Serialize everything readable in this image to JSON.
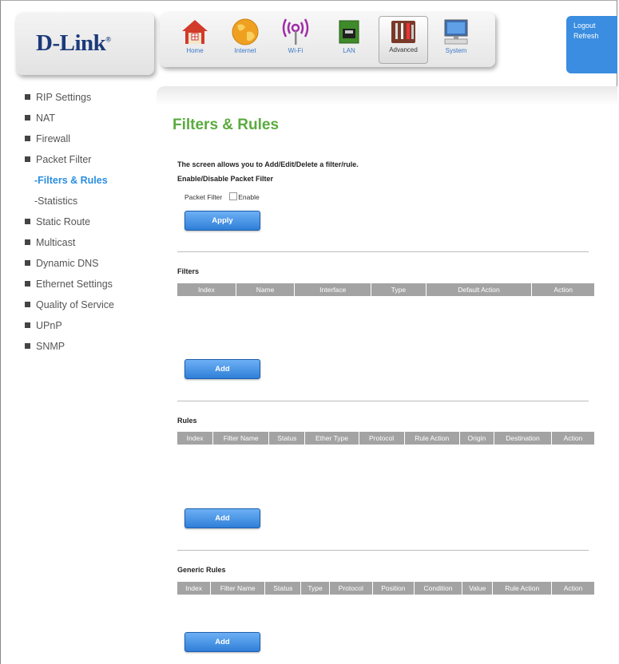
{
  "header": {
    "brand": "D-Link",
    "nav": [
      {
        "label": "Home",
        "icon": "home-icon",
        "active": false
      },
      {
        "label": "Internet",
        "icon": "globe-icon",
        "active": false
      },
      {
        "label": "Wi-Fi",
        "icon": "wifi-icon",
        "active": false
      },
      {
        "label": "LAN",
        "icon": "lan-port-icon",
        "active": false
      },
      {
        "label": "Advanced",
        "icon": "tools-icon",
        "active": true
      },
      {
        "label": "System",
        "icon": "computer-icon",
        "active": false
      }
    ],
    "logout": "Logout",
    "refresh": "Refresh",
    "accent_color": "#3a8de0"
  },
  "sidebar": {
    "items": [
      {
        "label": "RIP Settings"
      },
      {
        "label": "NAT"
      },
      {
        "label": "Firewall"
      },
      {
        "label": "Packet Filter"
      },
      {
        "label": "-Filters & Rules"
      },
      {
        "label": "-Statistics"
      },
      {
        "label": "Static Route"
      },
      {
        "label": "Multicast"
      },
      {
        "label": "Dynamic DNS"
      },
      {
        "label": "Ethernet Settings"
      },
      {
        "label": "Quality of Service"
      },
      {
        "label": "UPnP"
      },
      {
        "label": "SNMP"
      }
    ]
  },
  "main": {
    "title": "Filters & Rules",
    "description": "The screen allows you to Add/Edit/Delete a filter/rule.",
    "enable_heading": "Enable/Disable Packet Filter",
    "packet_filter_label": "Packet Filter",
    "enable_label": "Enable",
    "enable_checked": false,
    "apply_label": "Apply",
    "filters": {
      "title": "Filters",
      "columns": [
        "Index",
        "Name",
        "Interface",
        "Type",
        "Default Action",
        "Action"
      ],
      "add_label": "Add"
    },
    "rules": {
      "title": "Rules",
      "columns": [
        "Index",
        "Filter Name",
        "Status",
        "Ether Type",
        "Protocol",
        "Rule Action",
        "Origin",
        "Destination",
        "Action"
      ],
      "add_label": "Add"
    },
    "generic_rules": {
      "title": "Generic Rules",
      "columns": [
        "Index",
        "Filter Name",
        "Status",
        "Type",
        "Protocol",
        "Position",
        "Condition",
        "Value",
        "Rule Action",
        "Action"
      ],
      "add_label": "Add"
    },
    "title_color": "#5aab3f",
    "active_link_color": "#2a8ee0"
  }
}
